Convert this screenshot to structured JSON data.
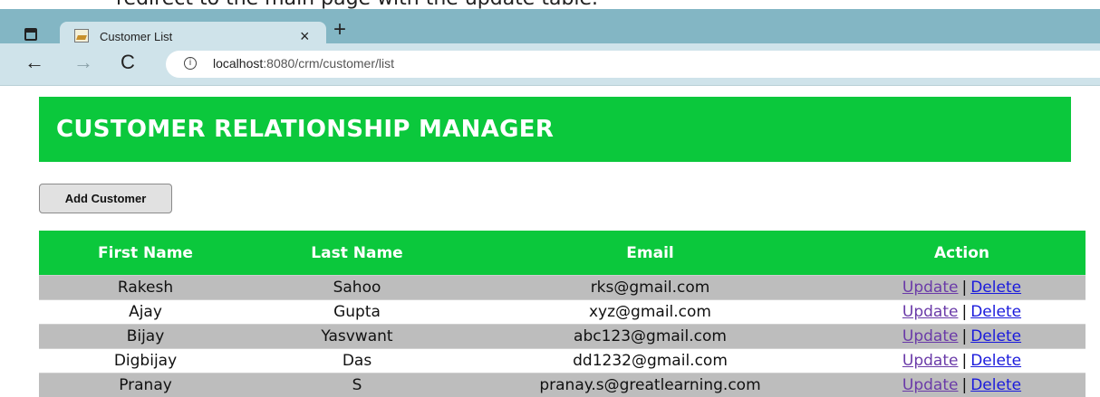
{
  "doc_caption": "redirect to the main page with the update table.",
  "browser": {
    "tab_title": "Customer List",
    "url_host": "localhost",
    "url_rest": ":8080/crm/customer/list",
    "icons": {
      "window": "window-icon",
      "close": "×",
      "new_tab": "+",
      "back": "←",
      "forward": "→",
      "reload": "C",
      "info": "i"
    }
  },
  "page": {
    "title": "CUSTOMER RELATIONSHIP MANAGER",
    "add_button_label": "Add Customer",
    "accent_color": "#0bc83c",
    "table": {
      "headers": [
        "First Name",
        "Last Name",
        "Email",
        "Action"
      ],
      "rows": [
        {
          "first": "Rakesh",
          "last": "Sahoo",
          "email": "rks@gmail.com"
        },
        {
          "first": "Ajay",
          "last": "Gupta",
          "email": "xyz@gmail.com"
        },
        {
          "first": "Bijay",
          "last": "Yasvwant",
          "email": "abc123@gmail.com"
        },
        {
          "first": "Digbijay",
          "last": "Das",
          "email": "dd1232@gmail.com"
        },
        {
          "first": "Pranay",
          "last": "S",
          "email": "pranay.s@greatlearning.com"
        }
      ],
      "update_label": "Update",
      "delete_label": "Delete",
      "separator": "|"
    }
  }
}
